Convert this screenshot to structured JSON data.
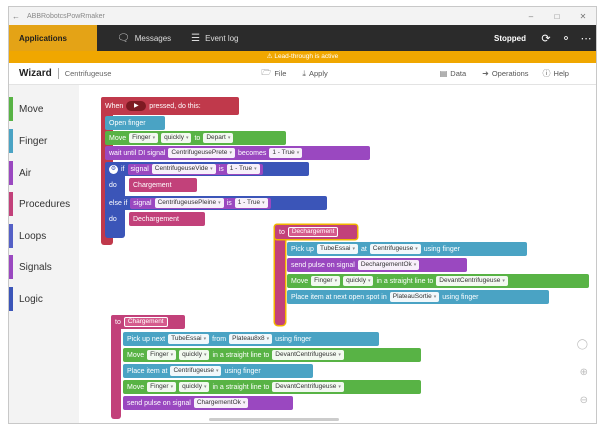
{
  "window": {
    "title": "ABBRobotcsPowRmaker"
  },
  "appbar": {
    "applications_label": "Applications",
    "messages_label": "Messages",
    "eventlog_label": "Event log",
    "status_label": "Stopped"
  },
  "warning": {
    "text": "Lead-through is active"
  },
  "wizard": {
    "title": "Wizard",
    "subtitle": "Centrifugeuse",
    "file_label": "File",
    "apply_label": "Apply",
    "data_label": "Data",
    "operations_label": "Operations",
    "help_label": "Help"
  },
  "palette": {
    "items": [
      {
        "label": "Move",
        "color": "#58b345"
      },
      {
        "label": "Finger",
        "color": "#4aa3c4"
      },
      {
        "label": "Air",
        "color": "#9a48c0"
      },
      {
        "label": "Procedures",
        "color": "#c2417a"
      },
      {
        "label": "Loops",
        "color": "#5460c6"
      },
      {
        "label": "Signals",
        "color": "#9a48c0"
      },
      {
        "label": "Logic",
        "color": "#3b55b8"
      }
    ]
  },
  "blocks": {
    "main": {
      "when": "When",
      "pressed": "pressed, do this:",
      "open_finger": "Open finger",
      "move": "Move",
      "finger": "Finger",
      "quickly": "quickly",
      "to": "to",
      "depart": "Depart",
      "wait_until": "wait until DI signal",
      "prete_signal": "CentrifugeusePrete",
      "becomes": "becomes",
      "true_val": "1 - True",
      "if": "if",
      "signal": "signal",
      "vide_signal": "CentrifugeuseVide",
      "is": "is",
      "do": "do",
      "chargement": "Chargement",
      "else_if": "else if",
      "pleine_signal": "CentrifugeusePleine",
      "dechargement": "Dechargement"
    },
    "dech_proc": {
      "to": "to",
      "name": "Dechargement",
      "pick_up": "Pick up",
      "tube": "TubeEssai",
      "at": "at",
      "centrifugeuse": "Centrifugeuse",
      "using_finger": "using finger",
      "send_pulse": "send pulse on signal",
      "signal": "DechargementOk",
      "move": "Move",
      "finger": "Finger",
      "quickly": "quickly",
      "straight": "in a straight line to",
      "target": "DevantCentrifugeuse",
      "place_item": "Place item at next open spot in",
      "plateau": "PlateauSortie"
    },
    "charg_proc": {
      "to": "to",
      "name": "Chargement",
      "pick_up_next": "Pick up next",
      "tube": "TubeEssai",
      "from": "from",
      "plateau": "Plateau8x8",
      "using_finger": "using finger",
      "move": "Move",
      "finger": "Finger",
      "quickly": "quickly",
      "straight": "in a straight line to",
      "target": "DevantCentrifugeuse",
      "place_item_at": "Place item at",
      "centrifugeuse": "Centrifugeuse",
      "send_pulse": "send pulse on signal",
      "signal": "ChargementOk"
    }
  }
}
